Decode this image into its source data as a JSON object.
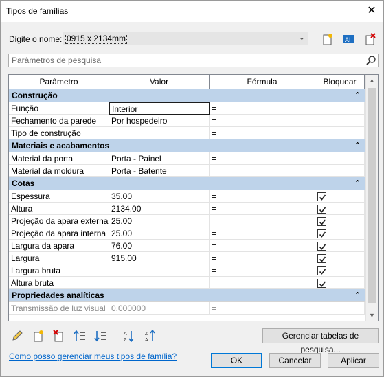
{
  "window": {
    "title": "Tipos de famílias",
    "close_glyph": "✕"
  },
  "name_row": {
    "label": "Digite o nome:",
    "value": "0915 x 2134mm"
  },
  "search": {
    "placeholder": "Parâmetros de pesquisa"
  },
  "grid": {
    "columns": [
      "Parâmetro",
      "Valor",
      "Fórmula",
      "Bloquear"
    ],
    "groups": [
      {
        "name": "Construção",
        "rows": [
          {
            "param": "Função",
            "value": "Interior",
            "formula": "=",
            "locked": false
          },
          {
            "param": "Fechamento da parede",
            "value": "Por hospedeiro",
            "formula": "=",
            "locked": false
          },
          {
            "param": "Tipo de construção",
            "value": "",
            "formula": "=",
            "locked": false
          }
        ]
      },
      {
        "name": "Materiais e acabamentos",
        "rows": [
          {
            "param": "Material da porta",
            "value": "Porta - Painel",
            "formula": "=",
            "locked": false
          },
          {
            "param": "Material da moldura",
            "value": "Porta - Batente",
            "formula": "=",
            "locked": false
          }
        ]
      },
      {
        "name": "Cotas",
        "rows": [
          {
            "param": "Espessura",
            "value": "35.00",
            "formula": "=",
            "locked": true
          },
          {
            "param": "Altura",
            "value": "2134.00",
            "formula": "=",
            "locked": true
          },
          {
            "param": "Projeção da apara externa",
            "value": "25.00",
            "formula": "=",
            "locked": true
          },
          {
            "param": "Projeção da apara interna",
            "value": "25.00",
            "formula": "=",
            "locked": true
          },
          {
            "param": "Largura da apara",
            "value": "76.00",
            "formula": "=",
            "locked": true
          },
          {
            "param": "Largura",
            "value": "915.00",
            "formula": "=",
            "locked": true
          },
          {
            "param": "Largura bruta",
            "value": "",
            "formula": "=",
            "locked": true
          },
          {
            "param": "Altura bruta",
            "value": "",
            "formula": "=",
            "locked": true
          }
        ]
      },
      {
        "name": "Propriedades analíticas",
        "rows": [
          {
            "param": "Transmissão de luz visual",
            "value": "0.000000",
            "formula": "=",
            "locked": false
          }
        ]
      }
    ]
  },
  "buttons": {
    "manage_lookup": "Gerenciar tabelas de pesquisa...",
    "ok": "OK",
    "cancel": "Cancelar",
    "apply": "Aplicar"
  },
  "help_link": "Como posso gerenciar meus tipos de família?",
  "colors": {
    "group_header_bg": "#bed3ea",
    "link": "#0066cc",
    "primary_border": "#0078d7"
  }
}
